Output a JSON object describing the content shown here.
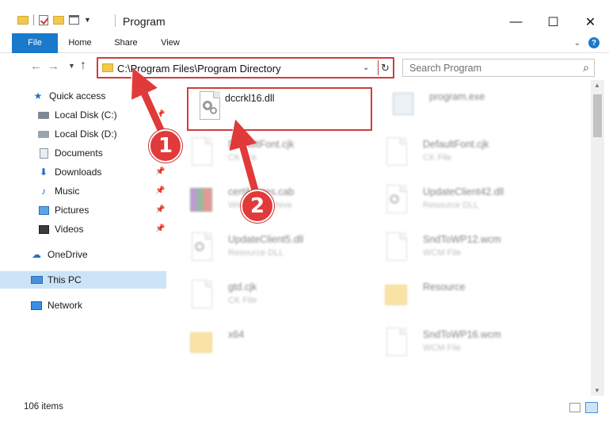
{
  "window": {
    "title": "Program",
    "minimize": "—",
    "maximize": "☐",
    "close": "✕"
  },
  "ribbon": {
    "tabs": [
      "File",
      "Home",
      "Share",
      "View"
    ]
  },
  "address": {
    "path": "C:\\Program Files\\Program Directory"
  },
  "search": {
    "placeholder": "Search Program"
  },
  "sidebar": {
    "items": [
      {
        "label": "Quick access",
        "icon": "star-icon"
      },
      {
        "label": "Local Disk (C:)",
        "icon": "drive-icon",
        "pinned": true
      },
      {
        "label": "Local Disk (D:)",
        "icon": "drive-icon"
      },
      {
        "label": "Documents",
        "icon": "documents-icon"
      },
      {
        "label": "Downloads",
        "icon": "download-icon",
        "pinned": true
      },
      {
        "label": "Music",
        "icon": "music-icon",
        "pinned": true
      },
      {
        "label": "Pictures",
        "icon": "pictures-icon",
        "pinned": true
      },
      {
        "label": "Videos",
        "icon": "videos-icon",
        "pinned": true
      },
      {
        "label": "OneDrive",
        "icon": "cloud-icon"
      },
      {
        "label": "This PC",
        "icon": "computer-icon",
        "selected": true
      },
      {
        "label": "Network",
        "icon": "network-icon"
      }
    ]
  },
  "files": [
    {
      "name": "dccrkl16.dll",
      "type": "",
      "icon": "dll-file-icon",
      "highlighted": true
    },
    {
      "name": "program.exe",
      "type": "",
      "icon": "exe-file-icon"
    },
    {
      "name": "DefaultFont.cjk",
      "type": "CK File",
      "icon": "file-icon"
    },
    {
      "name": "DefaultFont.cjk",
      "type": "CK File",
      "icon": "file-icon"
    },
    {
      "name": "certificates.cab",
      "type": "WinRAR archive",
      "icon": "archive-icon"
    },
    {
      "name": "UpdateClient42.dll",
      "type": "Resource DLL",
      "icon": "dll-file-icon"
    },
    {
      "name": "UpdateClient5.dll",
      "type": "Resource DLL",
      "icon": "dll-file-icon"
    },
    {
      "name": "SndToWP12.wcm",
      "type": "WCM File",
      "icon": "file-icon"
    },
    {
      "name": "gtd.cjk",
      "type": "CK File",
      "icon": "file-icon"
    },
    {
      "name": "Resource",
      "type": "",
      "icon": "folder-icon"
    },
    {
      "name": "x64",
      "type": "",
      "icon": "folder-icon"
    },
    {
      "name": "SndToWP16.wcm",
      "type": "WCM File",
      "icon": "file-icon"
    }
  ],
  "status": {
    "count": "106 items"
  },
  "callouts": {
    "one": "1",
    "two": "2"
  },
  "colors": {
    "accent": "#1979ca",
    "highlight": "#d33b3b",
    "selection": "#cce4f7"
  }
}
